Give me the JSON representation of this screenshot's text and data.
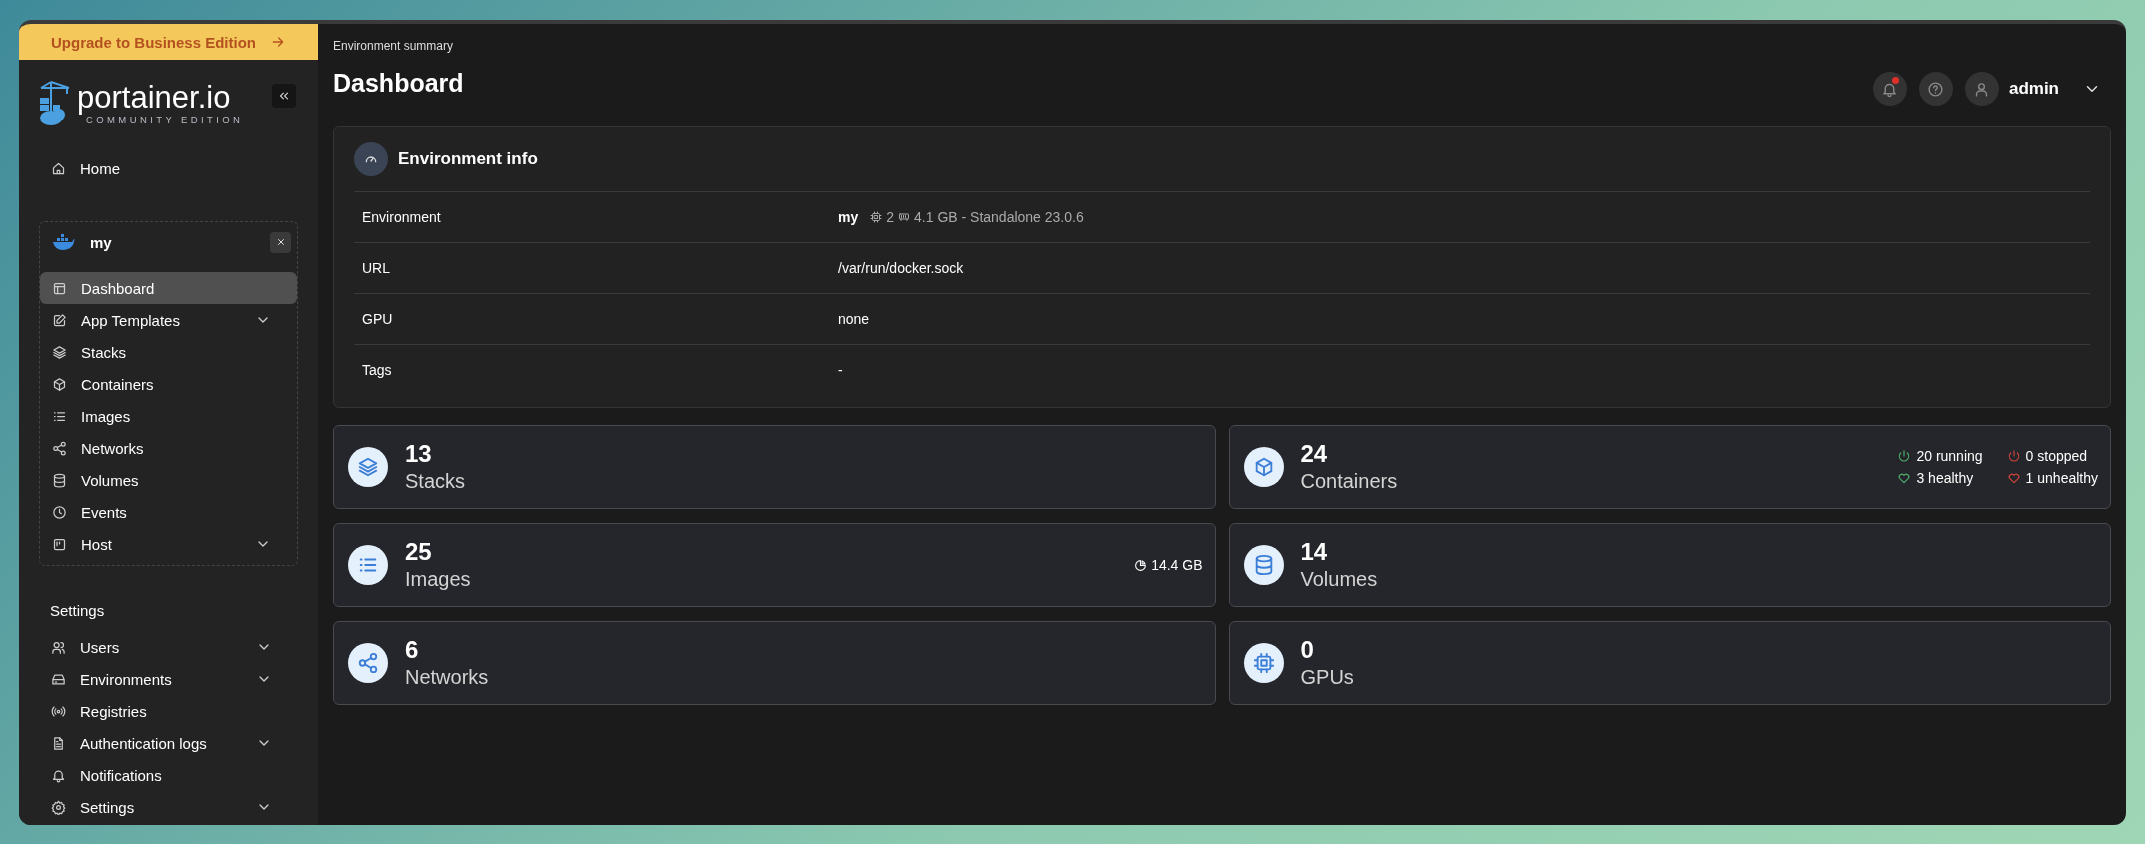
{
  "upgrade_banner": {
    "label": "Upgrade to Business Edition"
  },
  "logo": {
    "name": "portainer.io",
    "edition": "COMMUNITY EDITION"
  },
  "home": {
    "label": "Home",
    "selected": false,
    "expandable": false
  },
  "environment": {
    "name": "my",
    "items": [
      {
        "label": "Dashboard",
        "selected": true,
        "expandable": false
      },
      {
        "label": "App Templates",
        "selected": false,
        "expandable": true
      },
      {
        "label": "Stacks",
        "selected": false,
        "expandable": false
      },
      {
        "label": "Containers",
        "selected": false,
        "expandable": false
      },
      {
        "label": "Images",
        "selected": false,
        "expandable": false
      },
      {
        "label": "Networks",
        "selected": false,
        "expandable": false
      },
      {
        "label": "Volumes",
        "selected": false,
        "expandable": false
      },
      {
        "label": "Events",
        "selected": false,
        "expandable": false
      },
      {
        "label": "Host",
        "selected": false,
        "expandable": true
      }
    ]
  },
  "settings": {
    "heading": "Settings",
    "items": [
      {
        "label": "Users",
        "selected": false,
        "expandable": true
      },
      {
        "label": "Environments",
        "selected": false,
        "expandable": true
      },
      {
        "label": "Registries",
        "selected": false,
        "expandable": false
      },
      {
        "label": "Authentication logs",
        "selected": false,
        "expandable": true
      },
      {
        "label": "Notifications",
        "selected": false,
        "expandable": false
      },
      {
        "label": "Settings",
        "selected": false,
        "expandable": true
      }
    ]
  },
  "header": {
    "breadcrumb": "Environment summary",
    "title": "Dashboard",
    "notifications_unread": true,
    "user": "admin"
  },
  "environment_info": {
    "title": "Environment info",
    "rows": [
      {
        "kind": "environment",
        "label": "Environment",
        "name": "my",
        "cpus": "2",
        "details": "4.1 GB - Standalone 23.0.6"
      },
      {
        "kind": "text",
        "label": "URL",
        "value": "/var/run/docker.sock"
      },
      {
        "kind": "text",
        "label": "GPU",
        "value": "none"
      },
      {
        "kind": "text",
        "label": "Tags",
        "value": "-"
      }
    ]
  },
  "cards": [
    {
      "count": "13",
      "label": "Stacks"
    },
    {
      "count": "24",
      "label": "Containers",
      "stats": [
        {
          "kind": "running",
          "text": "20 running"
        },
        {
          "kind": "stopped",
          "text": "0 stopped"
        },
        {
          "kind": "healthy",
          "text": "3 healthy"
        },
        {
          "kind": "unhealthy",
          "text": "1 unhealthy"
        }
      ]
    },
    {
      "count": "25",
      "label": "Images",
      "size": "14.4 GB"
    },
    {
      "count": "14",
      "label": "Volumes"
    },
    {
      "count": "6",
      "label": "Networks"
    },
    {
      "count": "0",
      "label": "GPUs"
    }
  ]
}
